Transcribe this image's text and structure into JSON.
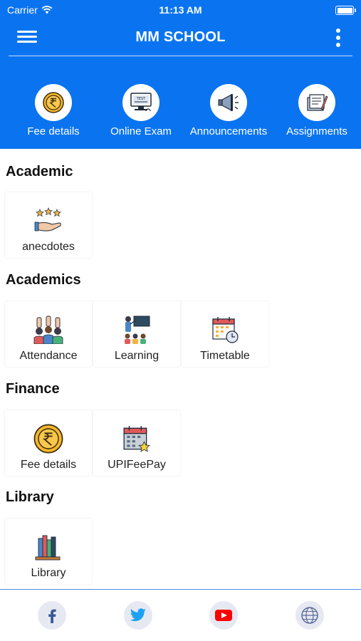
{
  "status_bar": {
    "carrier": "Carrier",
    "time": "11:13 AM"
  },
  "header": {
    "title": "MM SCHOOL"
  },
  "quick_actions": [
    {
      "label": "Fee details",
      "icon": "rupee-coin-icon"
    },
    {
      "label": "Online Exam",
      "icon": "online-test-icon"
    },
    {
      "label": "Announcements",
      "icon": "megaphone-icon"
    },
    {
      "label": "Assignments",
      "icon": "assignment-icon"
    }
  ],
  "sections": [
    {
      "title": "Academic",
      "tiles": [
        {
          "label": "anecdotes",
          "icon": "stars-hand-icon"
        }
      ]
    },
    {
      "title": "Academics",
      "tiles": [
        {
          "label": "Attendance",
          "icon": "raised-hands-icon"
        },
        {
          "label": "Learning",
          "icon": "classroom-icon"
        },
        {
          "label": "Timetable",
          "icon": "calendar-clock-icon"
        }
      ]
    },
    {
      "title": "Finance",
      "tiles": [
        {
          "label": "Fee details",
          "icon": "rupee-coin-icon"
        },
        {
          "label": "UPIFeePay",
          "icon": "calendar-star-icon"
        }
      ]
    },
    {
      "title": "Library",
      "tiles": [
        {
          "label": "Library",
          "icon": "books-icon"
        }
      ]
    }
  ],
  "footer": {
    "links": [
      "facebook-icon",
      "twitter-icon",
      "youtube-icon",
      "globe-icon"
    ]
  },
  "colors": {
    "primary": "#0a74f0",
    "footer_circle": "#e6e9f2"
  }
}
